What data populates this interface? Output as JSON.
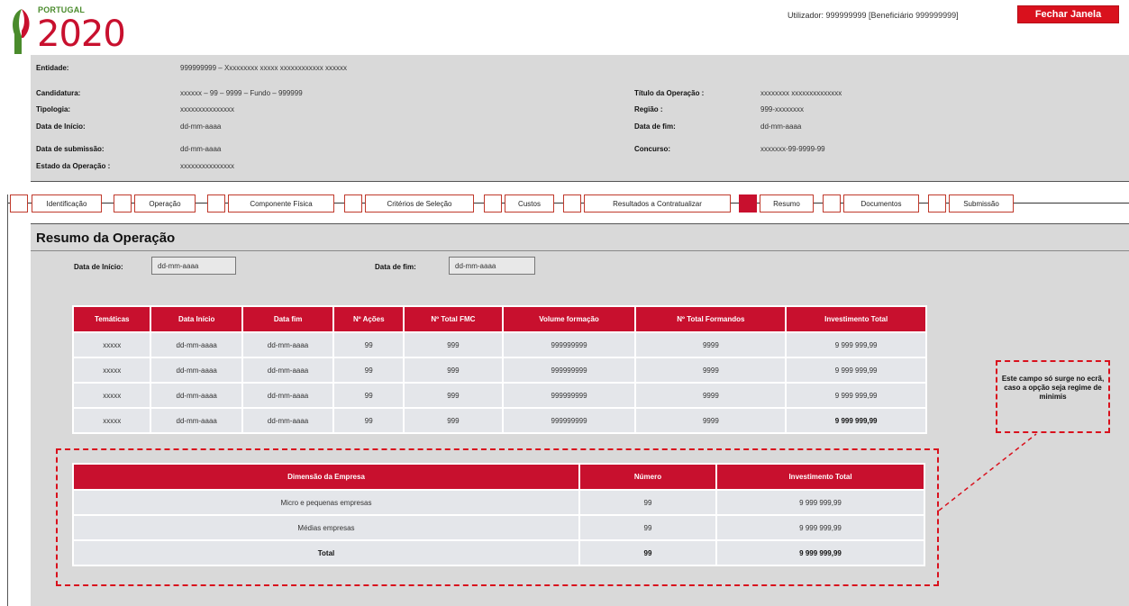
{
  "logo": {
    "country": "PORTUGAL",
    "year": "2020"
  },
  "header": {
    "user_info": "Utilizador: 999999999 [Beneficiário 999999999]",
    "close_label": "Fechar Janela"
  },
  "info": {
    "entidade": {
      "label": "Entidade:",
      "value": "999999999 – Xxxxxxxxx xxxxx xxxxxxxxxxxx xxxxxx"
    },
    "candidatura": {
      "label": "Candidatura:",
      "value": "xxxxxx – 99 – 9999 – Fundo – 999999"
    },
    "tipologia": {
      "label": "Tipologia:",
      "value": "xxxxxxxxxxxxxxx"
    },
    "data_inicio": {
      "label": "Data de Início:",
      "value": "dd-mm-aaaa"
    },
    "data_submissao": {
      "label": "Data de submissão:",
      "value": "dd-mm-aaaa"
    },
    "estado": {
      "label": "Estado da Operação :",
      "value": "xxxxxxxxxxxxxxx"
    },
    "titulo": {
      "label": "Título da Operação :",
      "value": "xxxxxxxx xxxxxxxxxxxxxx"
    },
    "regiao": {
      "label": "Região :",
      "value": "999-xxxxxxxx"
    },
    "data_fim": {
      "label": "Data de fim:",
      "value": "dd-mm-aaaa"
    },
    "concurso": {
      "label": "Concurso:",
      "value": "xxxxxxx-99-9999-99"
    }
  },
  "tabs": [
    {
      "label": "Identificação"
    },
    {
      "label": "Operação"
    },
    {
      "label": "Componente Física"
    },
    {
      "label": "Critérios de Seleção"
    },
    {
      "label": "Custos"
    },
    {
      "label": "Resultados a Contratualizar"
    },
    {
      "label": "Resumo"
    },
    {
      "label": "Documentos"
    },
    {
      "label": "Submissão"
    }
  ],
  "active_tab": "Resumo",
  "colors": {
    "accent": "#c8102e",
    "panel": "#d9d9d9"
  },
  "summary": {
    "title": "Resumo da Operação",
    "start_label": "Data de Início:",
    "start_value": "dd-mm-aaaa",
    "end_label": "Data de fim:",
    "end_value": "dd-mm-aaaa"
  },
  "main_table": {
    "headers": [
      "Temáticas",
      "Data Início",
      "Data fim",
      "Nº Ações",
      "Nº Total FMC",
      "Volume formação",
      "Nº Total Formandos",
      "Investimento Total"
    ],
    "rows": [
      [
        "xxxxx",
        "dd-mm-aaaa",
        "dd-mm-aaaa",
        "99",
        "999",
        "999999999",
        "9999",
        "9 999 999,99"
      ],
      [
        "xxxxx",
        "dd-mm-aaaa",
        "dd-mm-aaaa",
        "99",
        "999",
        "999999999",
        "9999",
        "9 999 999,99"
      ],
      [
        "xxxxx",
        "dd-mm-aaaa",
        "dd-mm-aaaa",
        "99",
        "999",
        "999999999",
        "9999",
        "9 999 999,99"
      ],
      [
        "xxxxx",
        "dd-mm-aaaa",
        "dd-mm-aaaa",
        "99",
        "999",
        "999999999",
        "9999",
        "9 999 999,99"
      ]
    ]
  },
  "size_table": {
    "headers": [
      "Dimensão da Empresa",
      "Número",
      "Investimento Total"
    ],
    "rows": [
      [
        "Micro e pequenas empresas",
        "99",
        "9 999 999,99"
      ],
      [
        "Médias empresas",
        "99",
        "9 999 999,99"
      ],
      [
        "Total",
        "99",
        "9 999 999,99"
      ]
    ]
  },
  "note": "Este campo só surge no ecrã, caso a opção seja regime de minimis"
}
